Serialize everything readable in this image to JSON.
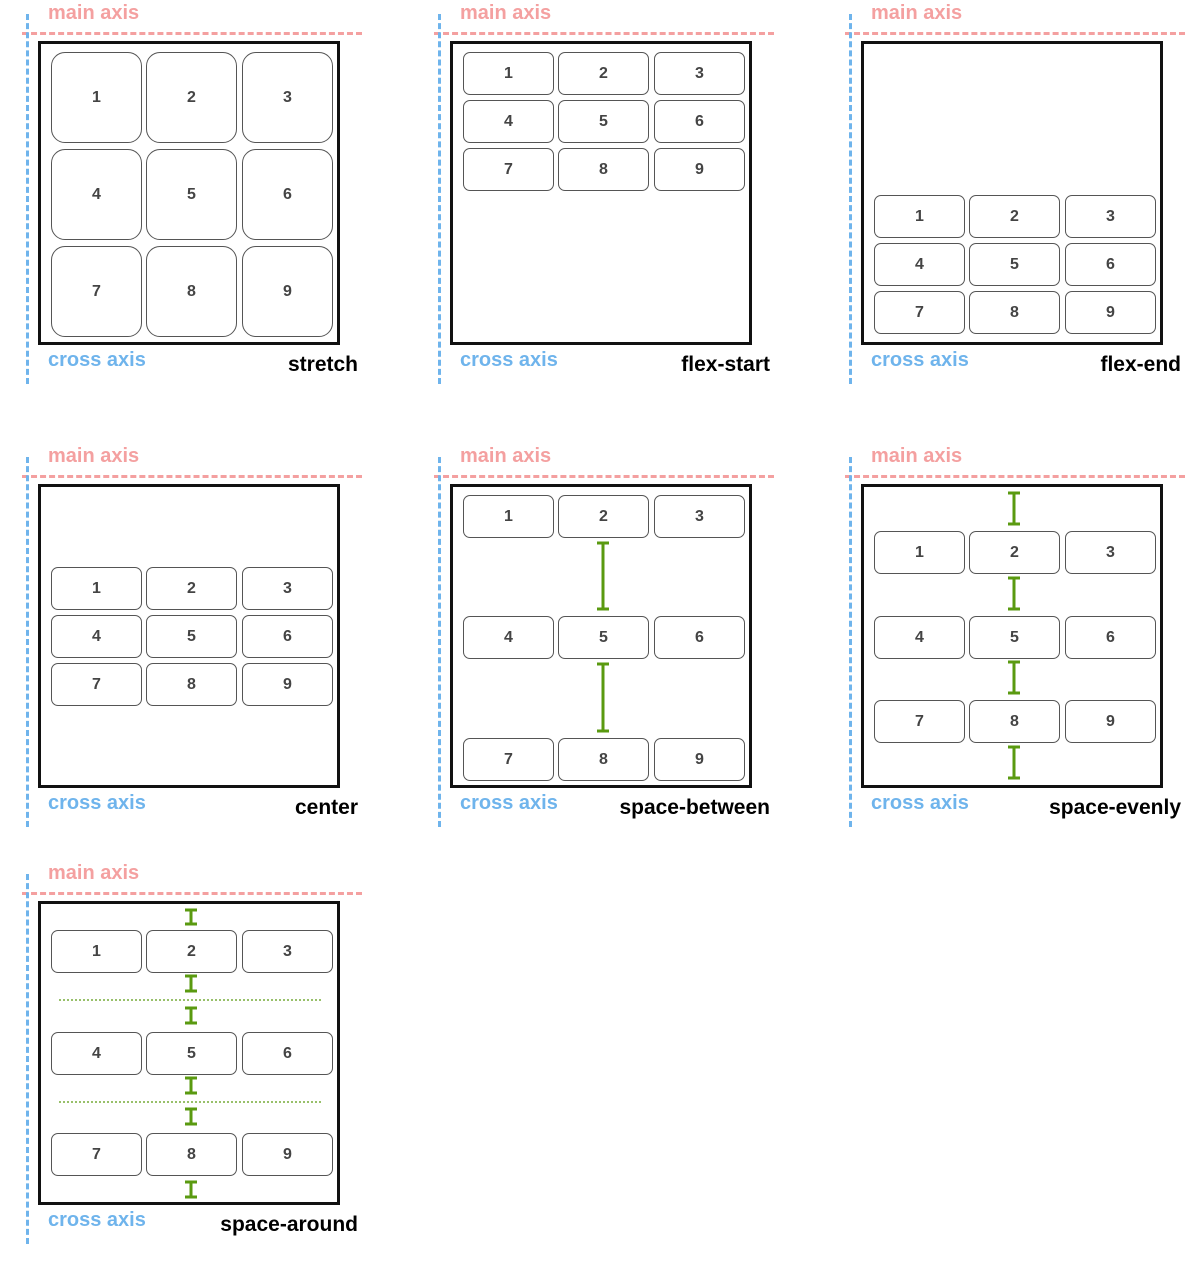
{
  "axes": {
    "main": "main axis",
    "cross": "cross axis"
  },
  "items": [
    "1",
    "2",
    "3",
    "4",
    "5",
    "6",
    "7",
    "8",
    "9"
  ],
  "colors": {
    "main_axis": "#f4a0a0",
    "cross_axis": "#6fb4ec",
    "gap_marker": "#5a9a10",
    "border": "#111111"
  },
  "panels": [
    {
      "mode": "stretch"
    },
    {
      "mode": "flex-start"
    },
    {
      "mode": "flex-end"
    },
    {
      "mode": "center"
    },
    {
      "mode": "space-between"
    },
    {
      "mode": "space-evenly"
    },
    {
      "mode": "space-around"
    }
  ]
}
